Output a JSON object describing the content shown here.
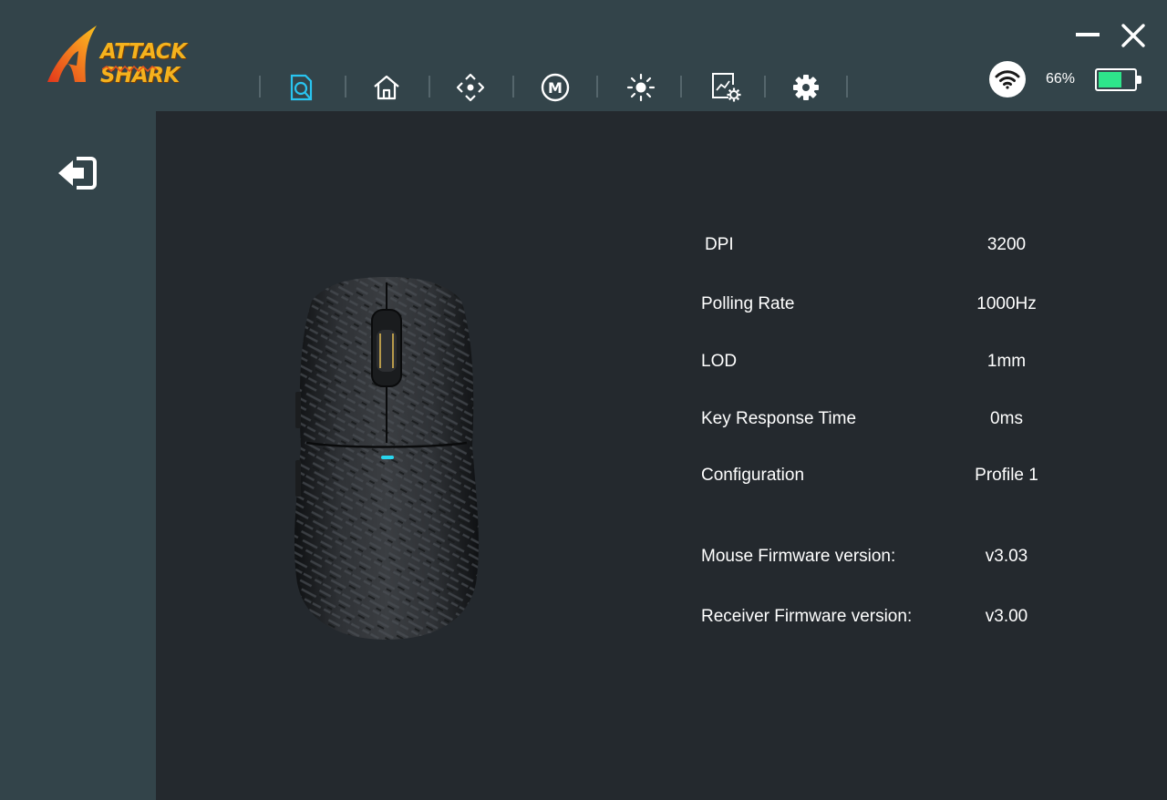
{
  "app": {
    "brand": "ATTACK SHARK"
  },
  "nav": {
    "items": [
      {
        "name": "info",
        "icon": "search-document-icon",
        "active": true
      },
      {
        "name": "home",
        "icon": "home-icon",
        "active": false
      },
      {
        "name": "dpi",
        "icon": "crosshair-move-icon",
        "active": false
      },
      {
        "name": "macro",
        "icon": "macro-m-icon",
        "active": false
      },
      {
        "name": "lighting",
        "icon": "sun-icon",
        "active": false
      },
      {
        "name": "performance",
        "icon": "chart-settings-icon",
        "active": false
      },
      {
        "name": "settings",
        "icon": "gear-icon",
        "active": false
      }
    ],
    "active_color": "#29c4f0"
  },
  "status": {
    "connection_icon": "wifi-icon",
    "battery_percent": 66,
    "battery_label": "66%",
    "battery_color": "#2ee58b"
  },
  "window": {
    "minimize_icon": "minimize-icon",
    "close_icon": "close-icon"
  },
  "sidebar": {
    "back_icon": "exit-arrow-icon"
  },
  "info": {
    "rows": [
      {
        "label": "DPI",
        "value": "3200"
      },
      {
        "label": "Polling Rate",
        "value": "1000Hz"
      },
      {
        "label": "LOD",
        "value": "1mm"
      },
      {
        "label": "Key Response Time",
        "value": "0ms"
      },
      {
        "label": "Configuration",
        "value": "Profile 1"
      },
      {
        "label": "Mouse Firmware version:",
        "value": "v3.03"
      },
      {
        "label": "Receiver Firmware version:",
        "value": "v3.00"
      }
    ]
  }
}
